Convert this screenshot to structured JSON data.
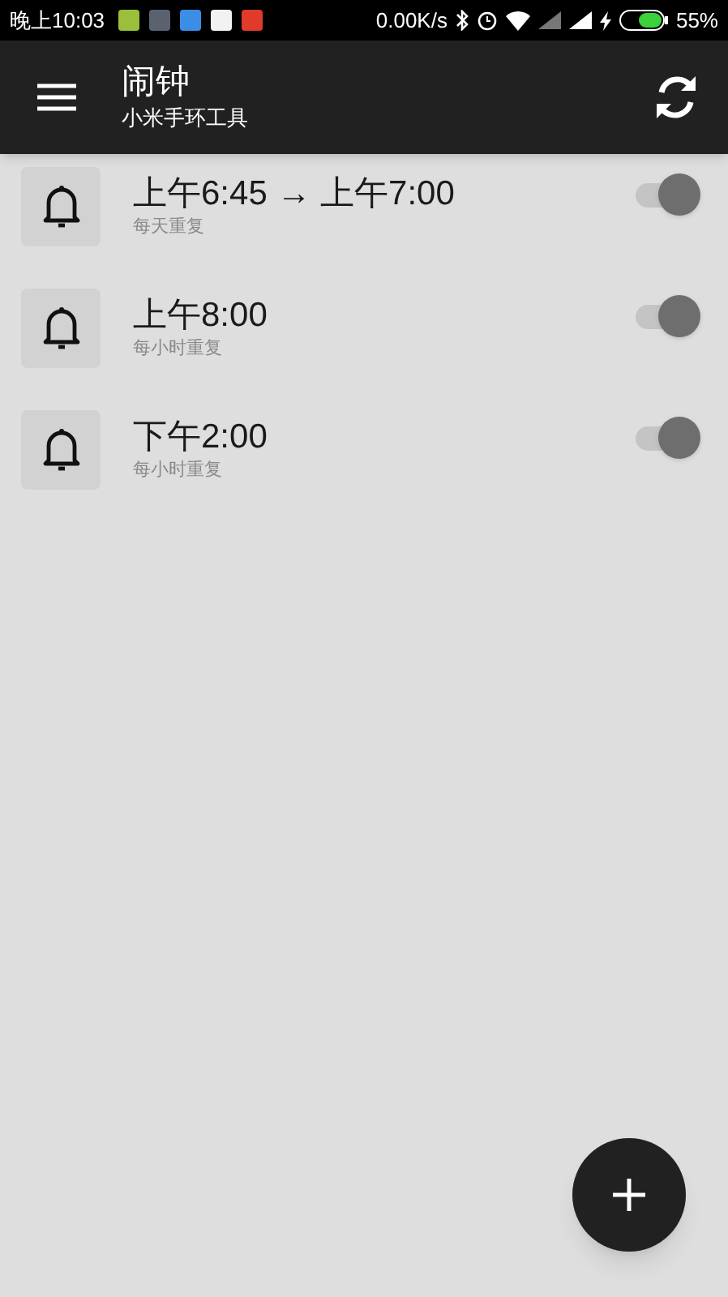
{
  "status_bar": {
    "time": "晚上10:03",
    "speed": "0.00K/s",
    "battery": "55%"
  },
  "app_bar": {
    "title": "闹钟",
    "subtitle": "小米手环工具"
  },
  "alarms": [
    {
      "time": "上午6:45 → 上午7:00",
      "repeat": "每天重复",
      "on": true
    },
    {
      "time": "上午8:00",
      "repeat": "每小时重复",
      "on": true
    },
    {
      "time": "下午2:00",
      "repeat": "每小时重复",
      "on": true
    }
  ]
}
